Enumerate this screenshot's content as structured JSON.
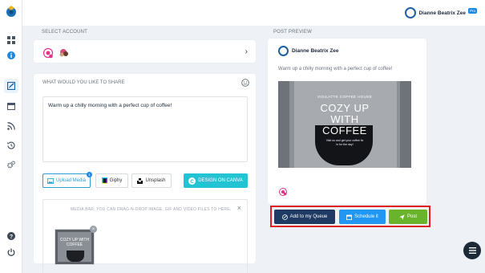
{
  "user": {
    "name": "Dianne Beatrix Zee",
    "plan_badge": "Pro"
  },
  "sections": {
    "select_account": "SELECT ACCOUNT",
    "post_preview": "POST PREVIEW"
  },
  "composer": {
    "title": "WHAT WOULD YOU LIKE TO SHARE",
    "text": "Warm up a chilly morning with a perfect cup of coffee!",
    "buttons": {
      "upload_media": "Upload Media",
      "upload_count": "1",
      "giphy": "Giphy",
      "unsplash": "Unsplash",
      "canva": "DESIGN ON CANVA"
    },
    "media_bar_hint": "MEDIA BAR, YOU CAN DRAG-N-DROP IMAGE, GIF AND VIDEO FILES TO HERE.",
    "thumbnail_text": "COZY UP WITH COFFEE"
  },
  "preview": {
    "name": "Dianne Beatrix Zee",
    "text": "Warm up a chilly morning with a perfect cup of coffee!",
    "image_sub": "VIGILATTE COFFEE HOUSE",
    "image_line1": "COZY UP",
    "image_line2": "WITH",
    "image_line3": "COFFEE",
    "image_small_line1": "Visit us and get your coffee fix",
    "image_small_line2": "in for the day!"
  },
  "actions": {
    "queue": "Add to my Queue",
    "schedule": "Schedule it",
    "post": "Post"
  },
  "colors": {
    "queue": "#1f3b63",
    "schedule": "#2196f3",
    "post": "#6ab42d",
    "highlight": "#e02020",
    "canva": "#22c4d4"
  },
  "icons": {
    "sidebar": [
      "grid-icon",
      "info-icon",
      "compose-icon",
      "calendar-icon",
      "rss-icon",
      "history-icon",
      "settings-icon",
      "help-icon",
      "power-icon"
    ]
  }
}
